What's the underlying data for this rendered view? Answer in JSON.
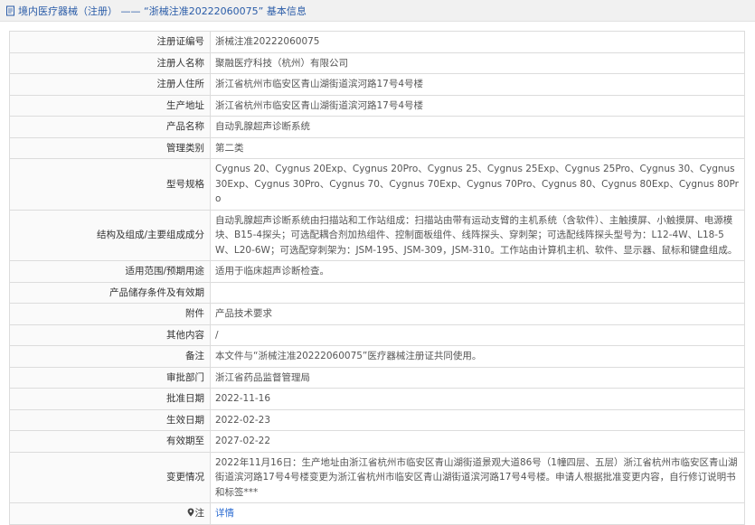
{
  "header": {
    "title": "境内医疗器械（注册） —— “浙械注准20222060075” 基本信息",
    "icon": "document-icon"
  },
  "rows": [
    {
      "label": "注册证编号",
      "value": "浙械注准20222060075"
    },
    {
      "label": "注册人名称",
      "value": "聚融医疗科技（杭州）有限公司"
    },
    {
      "label": "注册人住所",
      "value": "浙江省杭州市临安区青山湖街道滨河路17号4号楼"
    },
    {
      "label": "生产地址",
      "value": "浙江省杭州市临安区青山湖街道滨河路17号4号楼"
    },
    {
      "label": "产品名称",
      "value": "自动乳腺超声诊断系统"
    },
    {
      "label": "管理类别",
      "value": "第二类"
    },
    {
      "label": "型号规格",
      "value": "Cygnus 20、Cygnus 20Exp、Cygnus 20Pro、Cygnus 25、Cygnus 25Exp、Cygnus 25Pro、Cygnus 30、Cygnus 30Exp、Cygnus 30Pro、Cygnus 70、Cygnus 70Exp、Cygnus 70Pro、Cygnus 80、Cygnus 80Exp、Cygnus 80Pro"
    },
    {
      "label": "结构及组成/主要组成成分",
      "value": "自动乳腺超声诊断系统由扫描站和工作站组成：扫描站由带有运动支臂的主机系统（含软件）、主触摸屏、小触摸屏、电源模块、B15-4探头；可选配耦合剂加热组件、控制面板组件、线阵探头、穿刺架；可选配线阵探头型号为：L12-4W、L18-5W、L20-6W；可选配穿刺架为：JSM-195、JSM-309，JSM-310。工作站由计算机主机、软件、显示器、鼠标和键盘组成。"
    },
    {
      "label": "适用范围/预期用途",
      "value": "适用于临床超声诊断检查。"
    },
    {
      "label": "产品储存条件及有效期",
      "value": ""
    },
    {
      "label": "附件",
      "value": "产品技术要求"
    },
    {
      "label": "其他内容",
      "value": "/"
    },
    {
      "label": "备注",
      "value": "本文件与“浙械注准20222060075”医疗器械注册证共同使用。"
    },
    {
      "label": "审批部门",
      "value": "浙江省药品监督管理局"
    },
    {
      "label": "批准日期",
      "value": "2022-11-16"
    },
    {
      "label": "生效日期",
      "value": "2022-02-23"
    },
    {
      "label": "有效期至",
      "value": "2027-02-22"
    },
    {
      "label": "变更情况",
      "value": "2022年11月16日：生产地址由浙江省杭州市临安区青山湖街道景观大道86号（1幢四层、五层）浙江省杭州市临安区青山湖街道滨河路17号4号楼变更为浙江省杭州市临安区青山湖街道滨河路17号4号楼。申请人根据批准变更内容，自行修订说明书和标签***"
    }
  ],
  "note_row": {
    "label": "注",
    "icon": "map-pin-icon",
    "link": "详情"
  },
  "colors": {
    "link": "#2a6bd1",
    "title": "#2a5ca8",
    "border": "#dcdcdc"
  }
}
